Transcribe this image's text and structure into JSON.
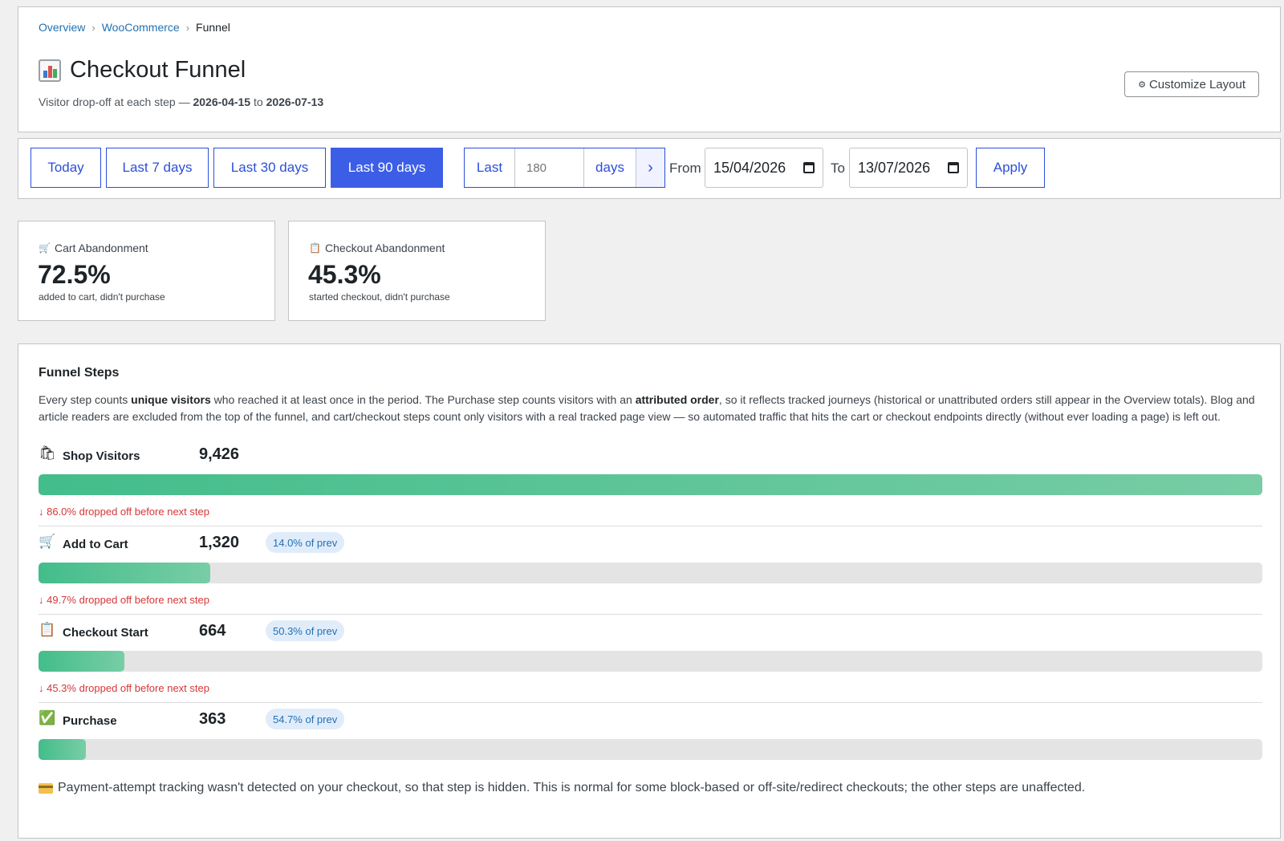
{
  "breadcrumb": {
    "item1": "Overview",
    "item2": "WooCommerce",
    "current": "Funnel",
    "separator": "›"
  },
  "header": {
    "title": "Checkout Funnel",
    "subtitle_prefix": "Visitor drop-off at each step — ",
    "date_from": "2026-04-15",
    "subtitle_mid": " to ",
    "date_to": "2026-07-13",
    "customize_label": "Customize Layout",
    "gear_glyph": "⚙"
  },
  "range": {
    "today": "Today",
    "last7": "Last 7 days",
    "last30": "Last 30 days",
    "last90": "Last 90 days",
    "active": "last90",
    "custom_last": "Last",
    "custom_days_placeholder": "180",
    "custom_days": "days",
    "custom_go": "›",
    "from_label": "From",
    "from_value": "15/04/2026",
    "to_label": "To",
    "to_value": "13/07/2026",
    "apply": "Apply"
  },
  "kpis": [
    {
      "label": "Cart Abandonment",
      "icon": "cart-icon",
      "glyph": "🛒",
      "value": "72.5%",
      "sub": "added to cart, didn't purchase"
    },
    {
      "label": "Checkout Abandonment",
      "icon": "clipboard-icon",
      "glyph": "📋",
      "value": "45.3%",
      "sub": "started checkout, didn't purchase"
    }
  ],
  "funnel": {
    "title": "Funnel Steps",
    "desc_1": "Every step counts ",
    "desc_b1": "unique visitors",
    "desc_2": " who reached it at least once in the period. The Purchase step counts visitors with an ",
    "desc_b2": "attributed order",
    "desc_3": ", so it reflects tracked journeys (historical or unattributed orders still appear in the Overview totals). Blog and article readers are excluded from the top of the funnel, and cart/checkout steps count only visitors with a real tracked page view — so automated traffic that hits the cart or checkout endpoints directly (without ever loading a page) is left out.",
    "steps": [
      {
        "name": "Shop Visitors",
        "icon": "shopping-bags-icon",
        "glyph": "🛍",
        "count": "9,426",
        "badge": "",
        "fill": 1.0,
        "drop": "↓ 86.0% dropped off before next step"
      },
      {
        "name": "Add to Cart",
        "icon": "cart-icon",
        "glyph": "🛒",
        "count": "1,320",
        "badge": "14.0% of prev",
        "fill": 0.14,
        "drop": "↓ 49.7% dropped off before next step"
      },
      {
        "name": "Checkout Start",
        "icon": "clipboard-icon",
        "glyph": "📋",
        "count": "664",
        "badge": "50.3% of prev",
        "fill": 0.0704,
        "drop": "↓ 45.3% dropped off before next step"
      },
      {
        "name": "Purchase",
        "icon": "check-box-icon",
        "glyph": "✅",
        "count": "363",
        "badge": "54.7% of prev",
        "fill": 0.0385,
        "drop": ""
      }
    ],
    "note": "Payment-attempt tracking wasn't detected on your checkout, so that step is hidden. This is normal for some block-based or off-site/redirect checkouts; the other steps are unaffected."
  }
}
